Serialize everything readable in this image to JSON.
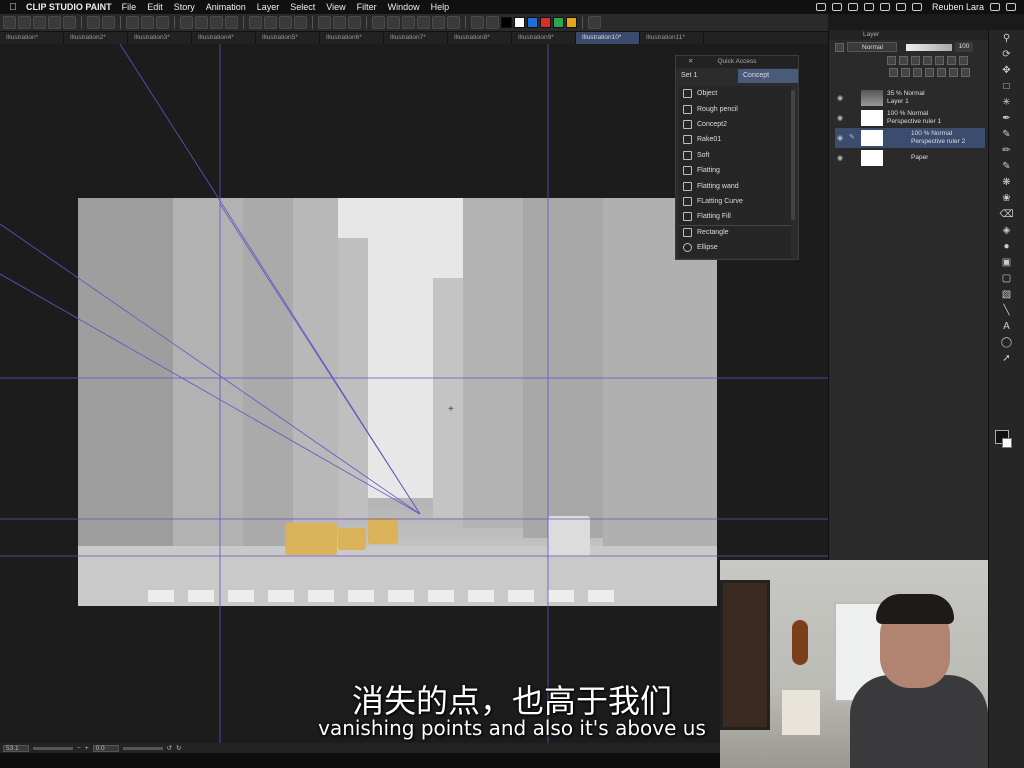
{
  "menubar": {
    "app_name": "CLIP STUDIO PAINT",
    "items": [
      "File",
      "Edit",
      "Story",
      "Animation",
      "Layer",
      "Select",
      "View",
      "Filter",
      "Window",
      "Help"
    ],
    "user": "Reuben Lara"
  },
  "toolbar": {
    "swatches": [
      "#000000",
      "#ffffff",
      "#1e6fd9",
      "#d93025",
      "#2da44e",
      "#e8a317"
    ]
  },
  "tabs": [
    "Illustration*",
    "Illustration2*",
    "Illustration3*",
    "Illustration4*",
    "Illustration5*",
    "Illustration6*",
    "Illustration7*",
    "Illustration8*",
    "Illustration9*",
    "Illustration10*",
    "Illustration11*"
  ],
  "active_tab": 9,
  "quick_access": {
    "title": "Quick Access",
    "set_left": "Set 1",
    "set_right": "Concept",
    "items": [
      "Object",
      "Rough pencil",
      "Concept2",
      "Rake01",
      "Soft",
      "Flatting",
      "Flatting wand",
      "FLatting Curve",
      "Flatting Fill",
      "Rectangle",
      "Ellipse"
    ]
  },
  "layer_panel": {
    "title": "Layer",
    "blend_mode": "Normal",
    "opacity": "100",
    "layers": [
      {
        "line1": "35 % Normal",
        "line2": "Layer 1"
      },
      {
        "line1": "100 % Normal",
        "line2": "Perspective ruler 1"
      },
      {
        "line1": "100 % Normal",
        "line2": "Perspective ruler 2"
      },
      {
        "line1": "",
        "line2": "Paper"
      }
    ]
  },
  "status": {
    "zoom": "53.1",
    "rotation": "0.0"
  },
  "subtitles": {
    "zh": "消失的点，也高于我们",
    "en": "vanishing points and also it's above us"
  }
}
